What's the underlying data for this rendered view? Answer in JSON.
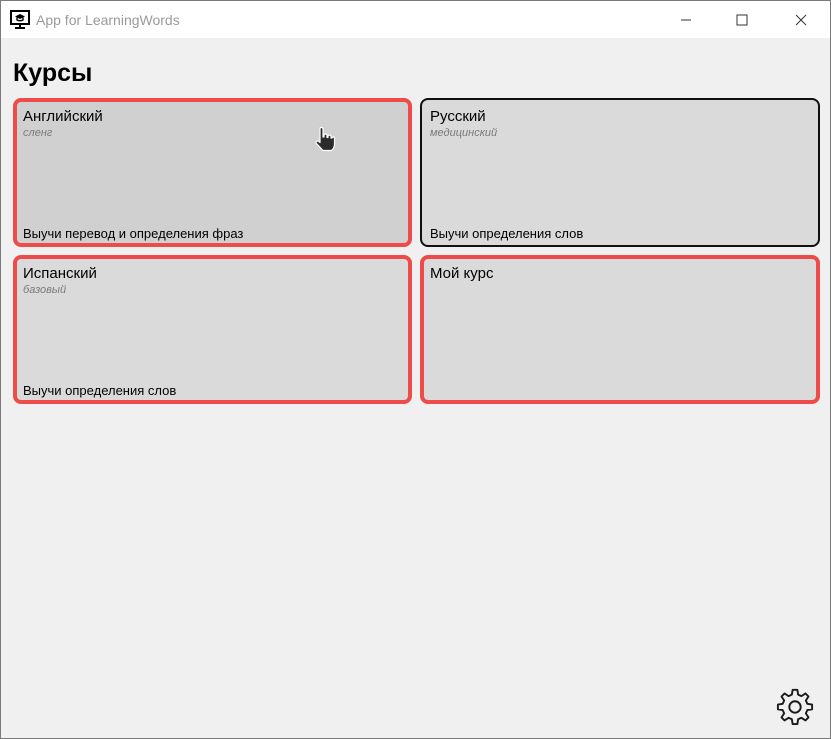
{
  "window": {
    "title": "App for LearningWords",
    "icon": "presentation-board-icon",
    "controls": [
      "minimize-icon",
      "maximize-icon",
      "close-icon"
    ]
  },
  "page": {
    "title": "Курсы"
  },
  "courses": [
    {
      "name": "Английский",
      "level": "сленг",
      "task": "Выучи перевод и определения фраз",
      "border": "#ee4b4b"
    },
    {
      "name": "Русский",
      "level": "медицинский",
      "task": "Выучи определения слов",
      "border": "#111111"
    },
    {
      "name": "Испанский",
      "level": "базовый",
      "task": "Выучи определения слов",
      "border": "#ee4b4b"
    },
    {
      "name": "Мой курс",
      "level": "",
      "task": "",
      "border": "#ee4b4b"
    }
  ],
  "footer": {
    "settings_icon": "gear-icon"
  },
  "colors": {
    "background": "#f0f0f0",
    "card": "#dadada",
    "accent_border": "#ee4b4b"
  }
}
